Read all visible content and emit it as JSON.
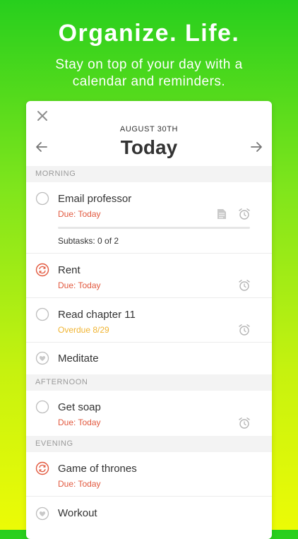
{
  "hero": {
    "title": "Organize. Life.",
    "subtitle": "Stay on top of your day with a calendar and reminders."
  },
  "card": {
    "date_label": "AUGUST 30TH",
    "day_title": "Today"
  },
  "sections": {
    "morning": "MORNING",
    "afternoon": "AFTERNOON",
    "evening": "EVENING"
  },
  "tasks": [
    {
      "title": "Email professor",
      "due": "Due: Today",
      "subtasks": "Subtasks: 0 of 2",
      "subtask_progress": 0,
      "icon": "circle-checkbox",
      "has_note": true,
      "has_alarm": true
    },
    {
      "title": "Rent",
      "due": "Due: Today",
      "icon": "repeat-icon",
      "has_alarm": true
    },
    {
      "title": "Read chapter 11",
      "due": "Overdue 8/29",
      "icon": "circle-checkbox",
      "has_alarm": true
    },
    {
      "title": "Meditate",
      "icon": "heart-icon"
    },
    {
      "title": "Get soap",
      "due": "Due: Today",
      "icon": "circle-checkbox",
      "has_alarm": true
    },
    {
      "title": "Game of thrones",
      "due": "Due: Today",
      "icon": "repeat-icon"
    },
    {
      "title": "Workout",
      "icon": "heart-icon"
    }
  ],
  "colors": {
    "due": "#e2583e",
    "overdue": "#f0b432",
    "repeat": "#e2583e",
    "icon_gray": "#b5b5b5"
  }
}
